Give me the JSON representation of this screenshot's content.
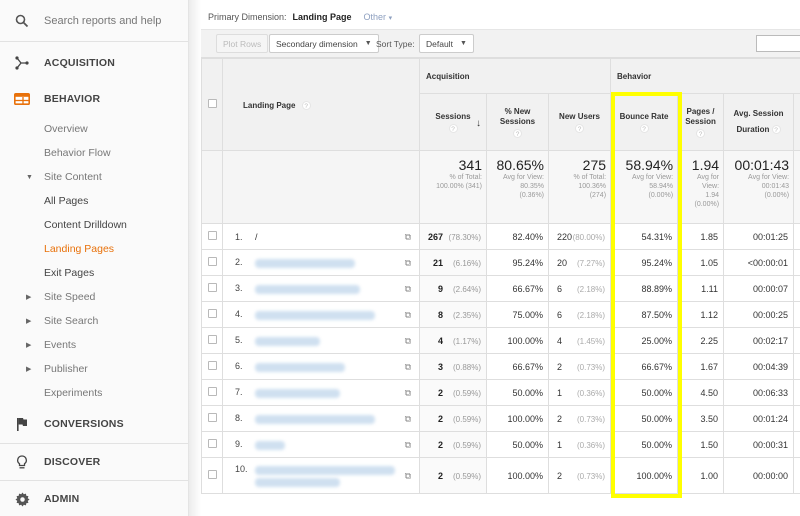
{
  "sidebar": {
    "search_placeholder": "Search reports and help",
    "sections": {
      "acquisition": "ACQUISITION",
      "behavior": "BEHAVIOR",
      "conversions": "CONVERSIONS",
      "discover": "DISCOVER",
      "admin": "ADMIN"
    },
    "behavior_items": [
      {
        "label": "Overview"
      },
      {
        "label": "Behavior Flow"
      },
      {
        "label": "Site Content",
        "expanded": true
      },
      {
        "label": "All Pages"
      },
      {
        "label": "Content Drilldown"
      },
      {
        "label": "Landing Pages",
        "selected": true
      },
      {
        "label": "Exit Pages"
      },
      {
        "label": "Site Speed",
        "collapsed": true
      },
      {
        "label": "Site Search",
        "collapsed": true
      },
      {
        "label": "Events",
        "collapsed": true
      },
      {
        "label": "Publisher",
        "collapsed": true
      },
      {
        "label": "Experiments"
      }
    ],
    "accent_color": "#e8710a"
  },
  "dimension": {
    "label": "Primary Dimension:",
    "current": "Landing Page",
    "other": "Other"
  },
  "toolbar": {
    "plot_rows": "Plot Rows",
    "secondary_dimension": "Secondary dimension",
    "sort_type_label": "Sort Type:",
    "sort_type_value": "Default",
    "search_value": ""
  },
  "table": {
    "groups": {
      "acquisition": "Acquisition",
      "behavior": "Behavior"
    },
    "columns": {
      "landing_page": "Landing Page",
      "sessions": "Sessions",
      "pct_new_sessions_1": "% New",
      "pct_new_sessions_2": "Sessions",
      "new_users": "New Users",
      "bounce_rate": "Bounce Rate",
      "pages_session_1": "Pages /",
      "pages_session_2": "Session",
      "avg_duration_1": "Avg. Session",
      "avg_duration_2": "Duration",
      "help": "?"
    },
    "totals": {
      "sessions": "341",
      "sessions_sub1": "% of Total:",
      "sessions_sub2": "100.00% (341)",
      "pct_new": "80.65%",
      "pct_new_sub1": "Avg for View:",
      "pct_new_sub2": "80.35%",
      "pct_new_sub3": "(0.36%)",
      "new_users": "275",
      "new_users_sub1": "% of Total:",
      "new_users_sub2": "100.36%",
      "new_users_sub3": "(274)",
      "bounce": "58.94%",
      "bounce_sub1": "Avg for View:",
      "bounce_sub2": "58.94%",
      "bounce_sub3": "(0.00%)",
      "pages": "1.94",
      "pages_sub1": "Avg for",
      "pages_sub2": "View:",
      "pages_sub3": "1.94",
      "pages_sub4": "(0.00%)",
      "duration": "00:01:43",
      "duration_sub1": "Avg for View:",
      "duration_sub2": "00:01:43",
      "duration_sub3": "(0.00%)"
    },
    "rows": [
      {
        "index": "1.",
        "page": "/",
        "sessions": "267",
        "sessions_pct": "(78.30%)",
        "pct_new": "82.40%",
        "new_users": "220",
        "new_users_pct": "(80.00%)",
        "bounce": "54.31%",
        "pages": "1.85",
        "duration": "00:01:25"
      },
      {
        "index": "2.",
        "page": "",
        "sessions": "21",
        "sessions_pct": "(6.16%)",
        "pct_new": "95.24%",
        "new_users": "20",
        "new_users_pct": "(7.27%)",
        "bounce": "95.24%",
        "pages": "1.05",
        "duration": "<00:00:01"
      },
      {
        "index": "3.",
        "page": "",
        "sessions": "9",
        "sessions_pct": "(2.64%)",
        "pct_new": "66.67%",
        "new_users": "6",
        "new_users_pct": "(2.18%)",
        "bounce": "88.89%",
        "pages": "1.11",
        "duration": "00:00:07"
      },
      {
        "index": "4.",
        "page": "",
        "sessions": "8",
        "sessions_pct": "(2.35%)",
        "pct_new": "75.00%",
        "new_users": "6",
        "new_users_pct": "(2.18%)",
        "bounce": "87.50%",
        "pages": "1.12",
        "duration": "00:00:25"
      },
      {
        "index": "5.",
        "page": "",
        "sessions": "4",
        "sessions_pct": "(1.17%)",
        "pct_new": "100.00%",
        "new_users": "4",
        "new_users_pct": "(1.45%)",
        "bounce": "25.00%",
        "pages": "2.25",
        "duration": "00:02:17"
      },
      {
        "index": "6.",
        "page": "",
        "sessions": "3",
        "sessions_pct": "(0.88%)",
        "pct_new": "66.67%",
        "new_users": "2",
        "new_users_pct": "(0.73%)",
        "bounce": "66.67%",
        "pages": "1.67",
        "duration": "00:04:39"
      },
      {
        "index": "7.",
        "page": "",
        "sessions": "2",
        "sessions_pct": "(0.59%)",
        "pct_new": "50.00%",
        "new_users": "1",
        "new_users_pct": "(0.36%)",
        "bounce": "50.00%",
        "pages": "4.50",
        "duration": "00:06:33"
      },
      {
        "index": "8.",
        "page": "",
        "sessions": "2",
        "sessions_pct": "(0.59%)",
        "pct_new": "100.00%",
        "new_users": "2",
        "new_users_pct": "(0.73%)",
        "bounce": "50.00%",
        "pages": "3.50",
        "duration": "00:01:24"
      },
      {
        "index": "9.",
        "page": "",
        "sessions": "2",
        "sessions_pct": "(0.59%)",
        "pct_new": "50.00%",
        "new_users": "1",
        "new_users_pct": "(0.36%)",
        "bounce": "50.00%",
        "pages": "1.50",
        "duration": "00:00:31"
      },
      {
        "index": "10.",
        "page": "",
        "sessions": "2",
        "sessions_pct": "(0.59%)",
        "pct_new": "100.00%",
        "new_users": "2",
        "new_users_pct": "(0.73%)",
        "bounce": "100.00%",
        "pages": "1.00",
        "duration": "00:00:00"
      }
    ],
    "highlight_color": "#ffff00"
  }
}
